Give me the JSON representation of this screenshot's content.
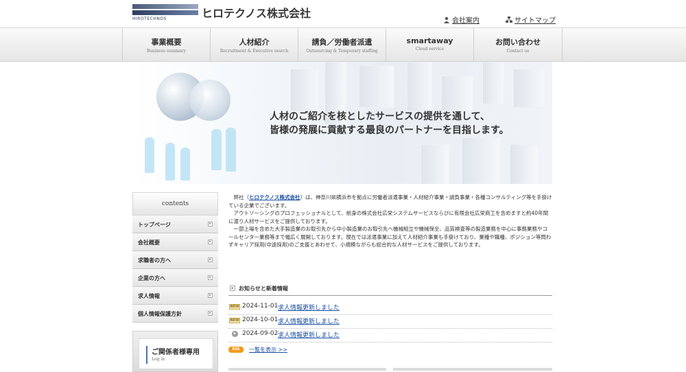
{
  "header": {
    "logo_text": "HIROTECHNOS",
    "company_name": "ヒロテクノス株式会社",
    "links": [
      {
        "label": "会社案内",
        "icon": "person-icon"
      },
      {
        "label": "サイトマップ",
        "icon": "sitemap-icon"
      }
    ]
  },
  "nav": [
    {
      "jp": "事業概要",
      "en": "Business summary"
    },
    {
      "jp": "人材紹介",
      "en": "Recruitment & Executive search"
    },
    {
      "jp": "請負／労働者派遣",
      "en": "Outsourcing & Temporary staffing"
    },
    {
      "jp": "smartaway",
      "en": "Cloud service"
    },
    {
      "jp": "お問い合わせ",
      "en": "Contact us"
    }
  ],
  "hero": {
    "line1": "人材のご紹介を核としたサービスの提供を通して、",
    "line2": "皆様の発展に貢献する最良のパートナーを目指します。"
  },
  "sidebar": {
    "heading": "contents",
    "items": [
      {
        "label": "トップページ"
      },
      {
        "label": "会社概要"
      },
      {
        "label": "求職者の方へ"
      },
      {
        "label": "企業の方へ"
      },
      {
        "label": "求人情報"
      },
      {
        "label": "個人情報保護方針"
      }
    ],
    "login": {
      "title": "ご関係者様専用",
      "subtitle": "Log in"
    }
  },
  "intro": {
    "p1_prefix": "弊社（",
    "p1_company": "ヒロテクノス株式会社",
    "p1_suffix": "）は、神奈川県横浜市を拠点に労働者派遣事業・人材紹介事業・請負事業・各種コンサルティング等を手掛けている企業でございます。",
    "p2": "アウトソーシングのプロフェッショナルとして、前身の株式会社広栄システムサービスならびに有限会社広栄商工を含めますと約40年間に渡り人材サービスをご提供しております。",
    "p3": "一部上場を含めた大手製造業のお取引先から中小製造業のお取引先へ機械組立や機械保全、品質検査等の製造業務を中心に事務業務やコールセンター業務等まで幅広く展開しております。現在では派遣事業に加えて人材紹介事業も手掛けており、業種や職種、ポジション等問わずキャリア採用(中途採用)のご支援とあわせて、小規模ながらも総合的な人材サービスをご提供しております。"
  },
  "news": {
    "heading": "お知らせと新着情報",
    "items": [
      {
        "badge": "NEW",
        "date": "2024-11-01",
        "title": "求人情報更新しました"
      },
      {
        "badge": "NEW",
        "date": "2024-10-01",
        "title": "求人情報更新しました"
      },
      {
        "badge": "",
        "date": "2024-09-02",
        "title": "求人情報更新しました"
      }
    ],
    "rss_label": "RSS",
    "view_all": "一覧を表示 >>"
  }
}
